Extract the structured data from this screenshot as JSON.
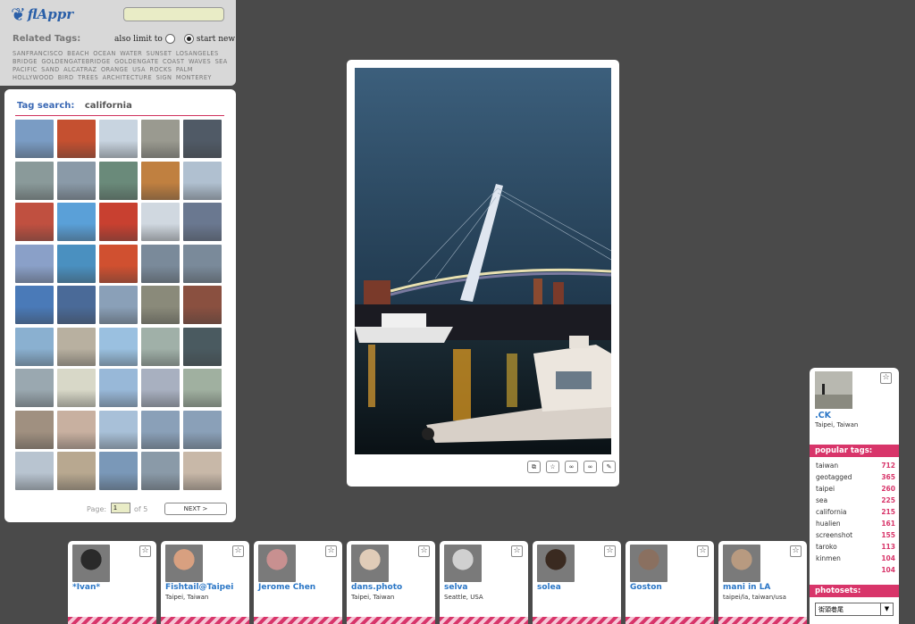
{
  "app": {
    "logo_text": "flAppr",
    "logo_accent": "r"
  },
  "search": {
    "value": ""
  },
  "related": {
    "label": "Related Tags:",
    "limit_label": "also limit to",
    "start_label": "start new",
    "tags": [
      "SANFRANCISCO",
      "BEACH",
      "OCEAN",
      "WATER",
      "SUNSET",
      "LOSANGELES",
      "BRIDGE",
      "GOLDENGATEBRIDGE",
      "GOLDENGATE",
      "COAST",
      "WAVES",
      "SEA",
      "PACIFIC",
      "SAND",
      "ALCATRAZ",
      "ORANGE",
      "USA",
      "ROCKS",
      "PALM",
      "HOLLYWOOD",
      "BIRD",
      "TREES",
      "ARCHITECTURE",
      "SIGN",
      "MONTEREY"
    ]
  },
  "tag_search": {
    "label": "Tag search:",
    "query": "california",
    "page_label": "Page:",
    "page_value": "1",
    "of_label": "of 5",
    "next_label": "NEXT >"
  },
  "main_photo": {
    "actions": [
      "⧉",
      "☆",
      "∞",
      "∞",
      "✎"
    ]
  },
  "user": {
    "name": ".CK",
    "location": "Taipei, Taiwan",
    "popular_label": "popular tags:",
    "popular_tags": [
      {
        "name": "taiwan",
        "count": "712"
      },
      {
        "name": "geotagged",
        "count": "365"
      },
      {
        "name": "taipei",
        "count": "260"
      },
      {
        "name": "sea",
        "count": "225"
      },
      {
        "name": "california",
        "count": "215"
      },
      {
        "name": "hualien",
        "count": "161"
      },
      {
        "name": "screenshot",
        "count": "155"
      },
      {
        "name": "taroko",
        "count": "113"
      },
      {
        "name": "kinmen",
        "count": "104"
      },
      {
        "name": "",
        "count": "104"
      }
    ],
    "photosets_label": "photosets:",
    "photoset_selected": "街頭巷尾"
  },
  "strip_users": [
    {
      "name": "*Ivan*",
      "location": ""
    },
    {
      "name": "Fishtail@Taipei",
      "location": "Taipei, Taiwan"
    },
    {
      "name": "Jerome Chen",
      "location": ""
    },
    {
      "name": "dans.photo",
      "location": "Taipei, Taiwan"
    },
    {
      "name": "selva",
      "location": "Seattle, USA"
    },
    {
      "name": "solea",
      "location": ""
    },
    {
      "name": "Goston",
      "location": ""
    },
    {
      "name": "mani in LA",
      "location": "taipei/la, taiwan/usa"
    }
  ]
}
